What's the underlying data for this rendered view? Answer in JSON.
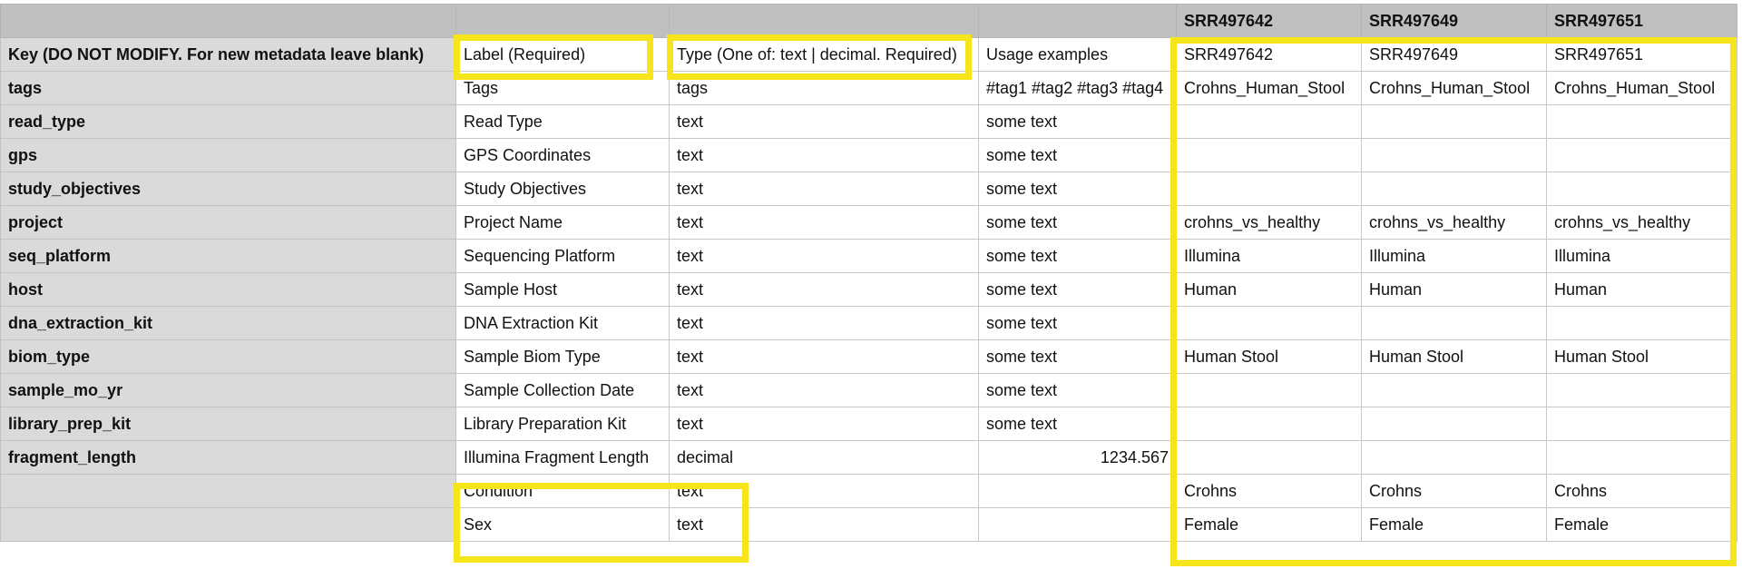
{
  "sheet": {
    "header_row": [
      "",
      "",
      "",
      "",
      "SRR497642",
      "SRR497649",
      "SRR497651"
    ],
    "rows": [
      [
        "Key (DO NOT MODIFY. For new metadata leave blank)",
        "Label (Required)",
        "Type (One of: text | decimal. Required)",
        "Usage examples",
        "SRR497642",
        "SRR497649",
        "SRR497651"
      ],
      [
        "tags",
        "Tags",
        "tags",
        "#tag1 #tag2 #tag3 #tag4",
        "Crohns_Human_Stool",
        "Crohns_Human_Stool",
        "Crohns_Human_Stool"
      ],
      [
        "read_type",
        "Read Type",
        "text",
        "some text",
        "",
        "",
        ""
      ],
      [
        "gps",
        "GPS Coordinates",
        "text",
        "some text",
        "",
        "",
        ""
      ],
      [
        "study_objectives",
        "Study Objectives",
        "text",
        "some text",
        "",
        "",
        ""
      ],
      [
        "project",
        "Project Name",
        "text",
        "some text",
        "crohns_vs_healthy",
        "crohns_vs_healthy",
        "crohns_vs_healthy"
      ],
      [
        "seq_platform",
        "Sequencing Platform",
        "text",
        "some text",
        "Illumina",
        "Illumina",
        "Illumina"
      ],
      [
        "host",
        "Sample Host",
        "text",
        "some text",
        "Human",
        "Human",
        "Human"
      ],
      [
        "dna_extraction_kit",
        "DNA Extraction Kit",
        "text",
        "some text",
        "",
        "",
        ""
      ],
      [
        "biom_type",
        "Sample Biom Type",
        "text",
        "some text",
        "Human Stool",
        "Human Stool",
        "Human Stool"
      ],
      [
        "sample_mo_yr",
        "Sample Collection Date",
        "text",
        "some text",
        "",
        "",
        ""
      ],
      [
        "library_prep_kit",
        "Library Preparation Kit",
        "text",
        "some text",
        "",
        "",
        ""
      ],
      [
        "fragment_length",
        "Illumina Fragment Length",
        "decimal",
        "1234.567",
        "",
        "",
        ""
      ],
      [
        "",
        "Condition",
        "text",
        "",
        "Crohns",
        "Crohns",
        "Crohns"
      ],
      [
        "",
        "Sex",
        "text",
        "",
        "Female",
        "Female",
        "Female"
      ]
    ]
  },
  "colors": {
    "highlight": "#f7e51b",
    "header_background": "#c0c0c0",
    "key_column_background": "#dadada",
    "grid_line": "#c8c8c8"
  }
}
